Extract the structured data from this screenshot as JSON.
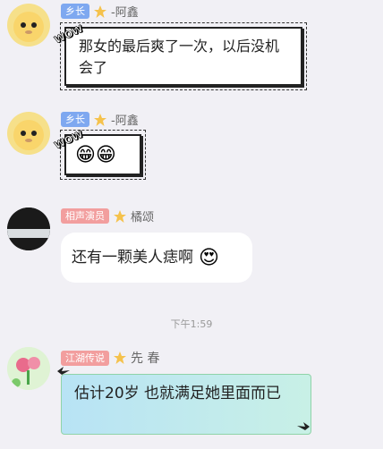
{
  "messages": [
    {
      "badge": "乡长",
      "name": "-阿鑫",
      "text": "那女的最后爽了一次，以后没机会了",
      "sticker": "WOW"
    },
    {
      "badge": "乡长",
      "name": "-阿鑫",
      "emoji": "😁😁",
      "sticker": "WOW"
    },
    {
      "badge": "相声演员",
      "name": "橘颂",
      "text": "还有一颗美人痣啊",
      "emoji": "😍"
    },
    {
      "badge": "江湖传说",
      "name": "先 春",
      "text": "估计20岁  也就满足她里面而已"
    }
  ],
  "timestamp": "下午1:59",
  "colors": {
    "badge_blue": "#7ea8f0",
    "badge_pink": "#f29e9e",
    "star": "#f5c24c",
    "green_border": "#8fd3a8"
  }
}
